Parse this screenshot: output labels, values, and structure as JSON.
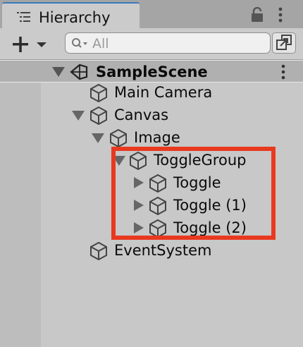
{
  "tab": {
    "title": "Hierarchy"
  },
  "search": {
    "placeholder": "All"
  },
  "scene": {
    "name": "SampleScene"
  },
  "rows": [
    {
      "label": "Main Camera"
    },
    {
      "label": "Canvas"
    },
    {
      "label": "Image"
    },
    {
      "label": "ToggleGroup"
    },
    {
      "label": "Toggle"
    },
    {
      "label": "Toggle (1)"
    },
    {
      "label": "Toggle (2)"
    },
    {
      "label": "EventSystem"
    }
  ],
  "icons": {
    "tab": "hierarchy-list-icon",
    "lock": "lock-icon",
    "more": "more-vertical-icon",
    "create": "plus-icon",
    "search": "search-icon",
    "scene": "unity-logo-icon",
    "gameobject": "cube-icon"
  },
  "colors": {
    "highlight": "#e8391f",
    "tab_accent": "#3a79bb"
  }
}
